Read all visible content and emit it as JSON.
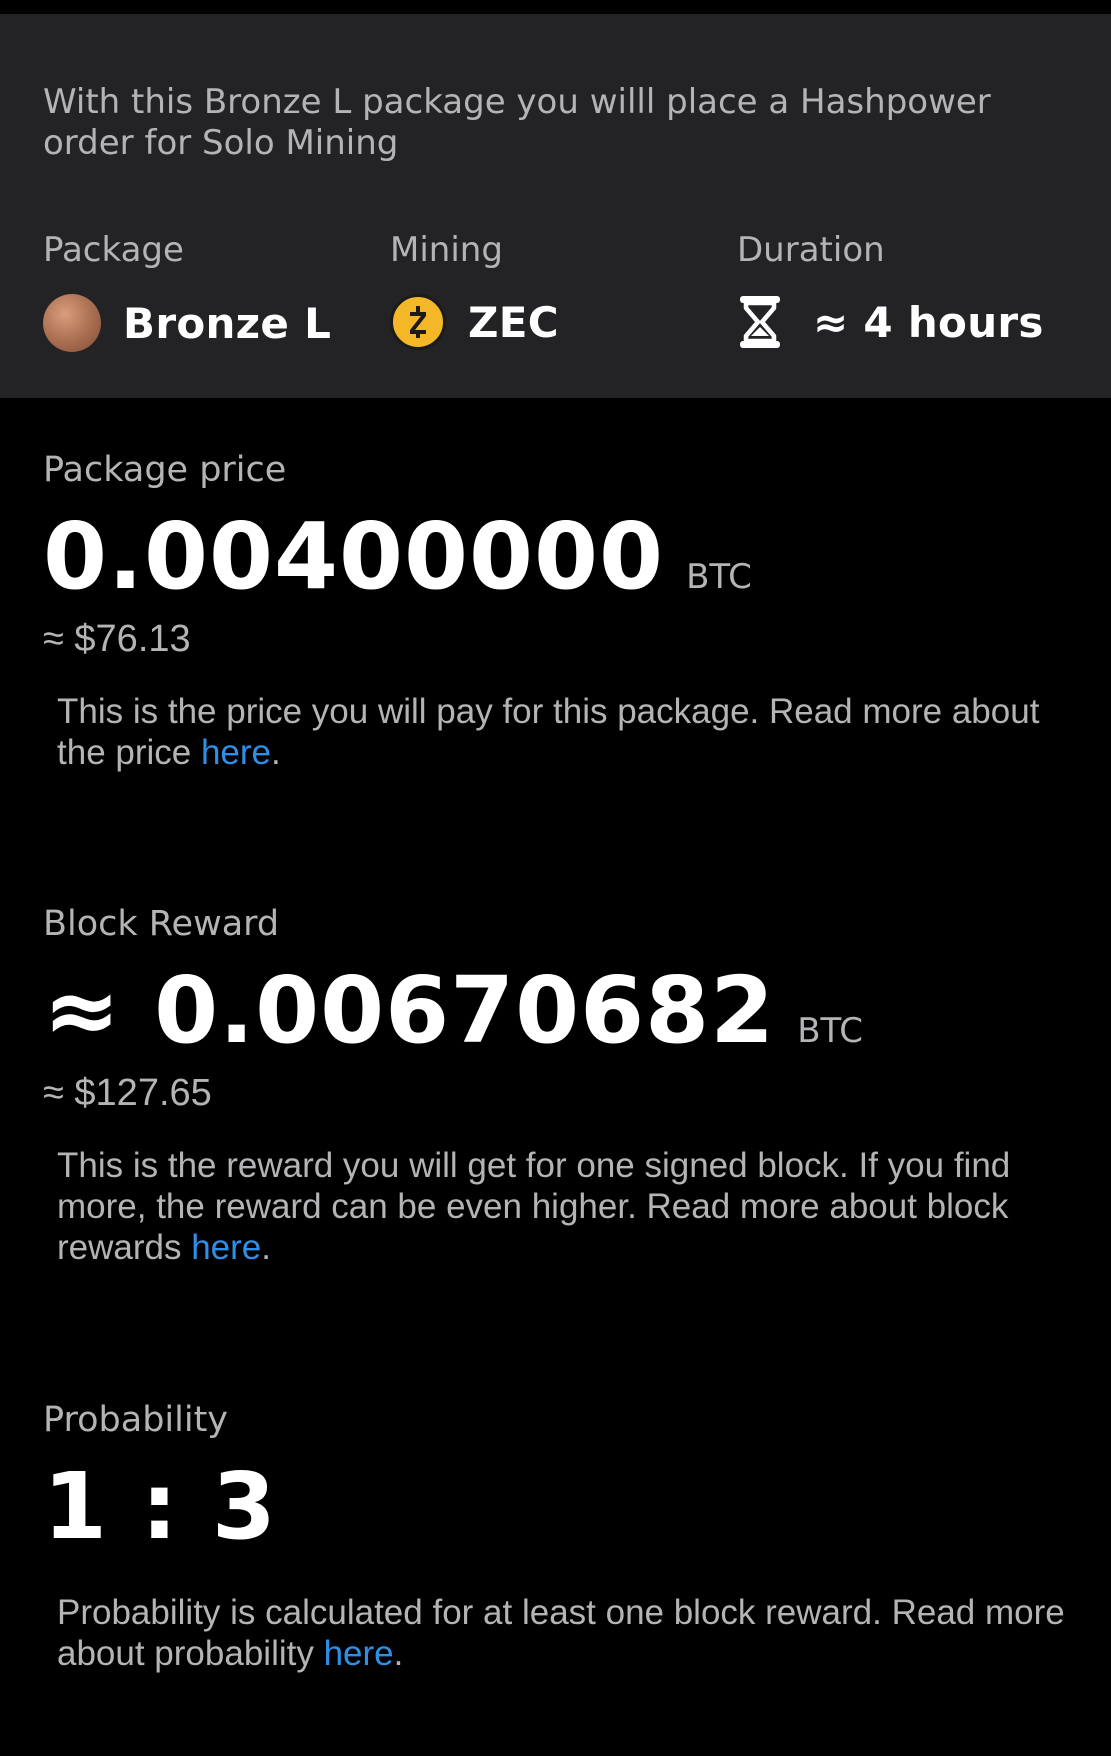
{
  "summary": {
    "intro": "With this Bronze L package you willl place a Hashpower order for Solo Mining",
    "package": {
      "label": "Package",
      "value": "Bronze L",
      "icon": "bronze-medal-icon"
    },
    "mining": {
      "label": "Mining",
      "value": "ZEC",
      "icon": "zec-coin-icon",
      "icon_symbol": "ⓩ"
    },
    "duration": {
      "label": "Duration",
      "value": "≈ 4 hours",
      "icon": "hourglass-icon"
    }
  },
  "price": {
    "label": "Package price",
    "value": "0.00400000",
    "unit": "BTC",
    "fiat": "≈ $76.13",
    "desc": "This is the price you will pay for this package. Read more about the price ",
    "link": "here",
    "end": "."
  },
  "reward": {
    "label": "Block Reward",
    "value": "≈ 0.00670682",
    "unit": "BTC",
    "fiat": "≈ $127.65",
    "desc": "This is the reward you will get for one signed block. If you find more, the reward can be even higher. Read more about block rewards ",
    "link": "here",
    "end": "."
  },
  "probability": {
    "label": "Probability",
    "value": "1 : 3",
    "desc": "Probability is calculated for at least one block reward. Read more about probability ",
    "link": "here",
    "end": "."
  },
  "colors": {
    "link": "#2f8fe6",
    "zec": "#f4b728",
    "panel": "#232325"
  }
}
